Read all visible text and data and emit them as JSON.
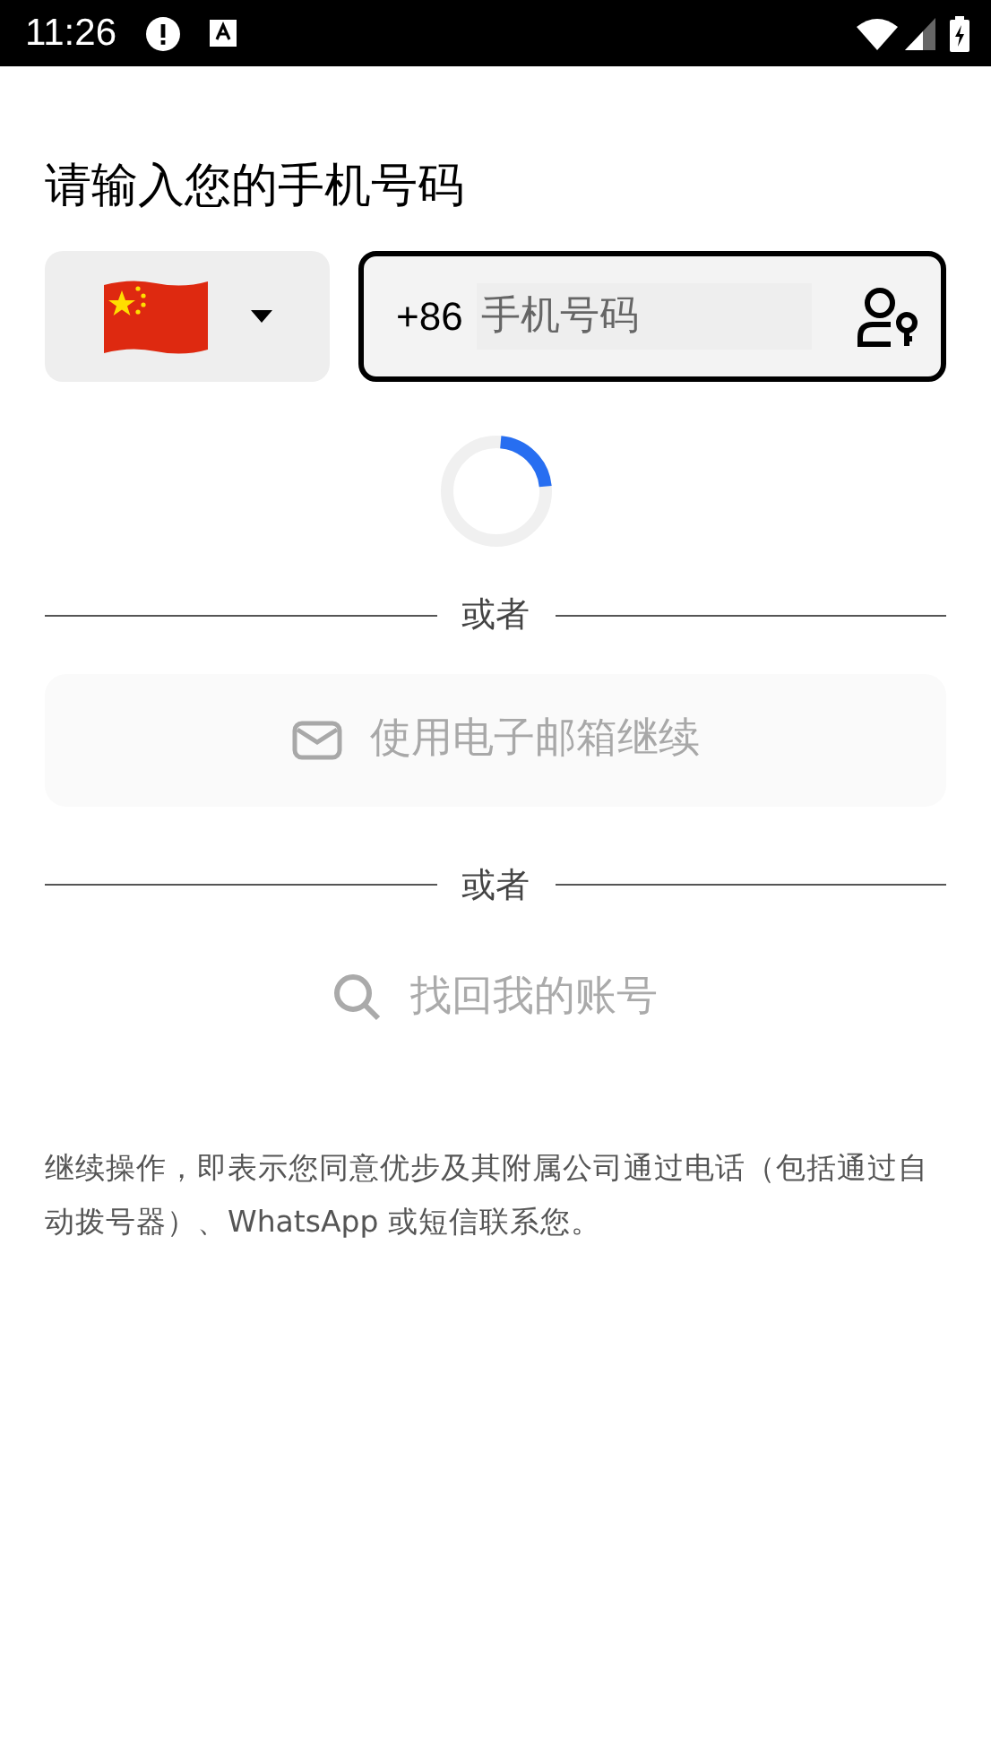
{
  "status_bar": {
    "time": "11:26"
  },
  "title": "请输入您的手机号码",
  "phone": {
    "country_code": "+86",
    "placeholder": "手机号码",
    "focused": true,
    "loading": true
  },
  "dividers": [
    "或者",
    "或者"
  ],
  "email_button": {
    "label": "使用电子邮箱继续",
    "disabled": true
  },
  "recover_link": {
    "label": "找回我的账号",
    "disabled": true
  },
  "disclaimer": "继续操作，即表示您同意优步及其附属公司通过电话（包括通过自动拨号器）、WhatsApp 或短信联系您。"
}
